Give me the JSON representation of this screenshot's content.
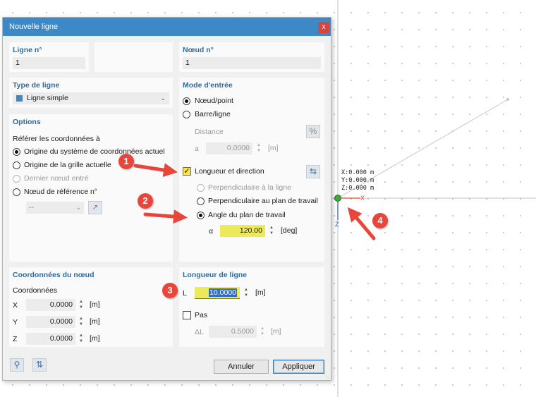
{
  "dialog": {
    "title": "Nouvelle ligne",
    "close_label": "x"
  },
  "line_no": {
    "label": "Ligne n°",
    "value": "1"
  },
  "node_no": {
    "label": "Nœud n°",
    "value": "1"
  },
  "line_type": {
    "label": "Type de ligne",
    "value": "Ligne simple",
    "swatch_color": "#3d89c8"
  },
  "options": {
    "title": "Options",
    "refer_label": "Référer les coordonnées à",
    "radios": [
      {
        "label": "Origine du système de coordonnées actuel",
        "selected": true,
        "enabled": true
      },
      {
        "label": "Origine de la grille actuelle",
        "selected": false,
        "enabled": true
      },
      {
        "label": "Dernier nœud entré",
        "selected": false,
        "enabled": false
      },
      {
        "label": "Nœud de référence n°",
        "selected": false,
        "enabled": true
      }
    ],
    "ref_node_value": "--"
  },
  "input_mode": {
    "title": "Mode d'entrée",
    "node_point": "Nœud/point",
    "bar_line": "Barre/ligne",
    "distance_label": "Distance",
    "percent_label": "%",
    "a_label": "a",
    "a_value": "0.0000",
    "a_unit": "[m]",
    "length_direction": "Longueur et direction",
    "perp_line": "Perpendiculaire à la ligne",
    "perp_plane": "Perpendiculaire au plan de travail",
    "angle_plane": "Angle du plan de travail",
    "alpha_label": "α",
    "alpha_value": "120.00",
    "alpha_unit": "[deg]"
  },
  "node_coords": {
    "title": "Coordonnées du nœud",
    "coords_label": "Coordonnées",
    "rows": [
      {
        "axis": "X",
        "value": "0.0000",
        "unit": "[m]"
      },
      {
        "axis": "Y",
        "value": "0.0000",
        "unit": "[m]"
      },
      {
        "axis": "Z",
        "value": "0.0000",
        "unit": "[m]"
      }
    ]
  },
  "line_length": {
    "title": "Longueur de ligne",
    "l_label": "L",
    "l_value": "10.0000",
    "l_unit": "[m]",
    "step_label": "Pas",
    "dl_label": "ΔL",
    "dl_value": "0.5000",
    "dl_unit": "[m]"
  },
  "footer": {
    "cancel": "Annuler",
    "apply": "Appliquer"
  },
  "viewport": {
    "x_readout": "X:0.000 m",
    "y_readout": "Y:0.000 m",
    "z_readout": "Z:0.000 m",
    "x_axis": "X",
    "z_axis": "Z"
  },
  "markers": [
    "1",
    "2",
    "3",
    "4"
  ],
  "colors": {
    "titlebar": "#3d89c8",
    "section_title": "#2d6b9f",
    "highlight": "#ffe34a",
    "arrow": "#e8463a",
    "node": "#3cab3c"
  }
}
